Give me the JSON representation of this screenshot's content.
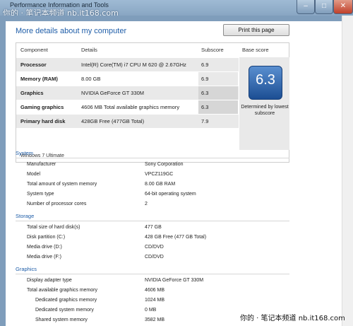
{
  "window": {
    "title": "Performance Information and Tools",
    "watermark_top": "你的 · 笔记本频道 nb.it168.com",
    "minimize": "–",
    "maximize": "□",
    "close": "✕"
  },
  "heading": "More details about my computer",
  "print_button": "Print this page",
  "score_table": {
    "headers": [
      "Component",
      "Details",
      "Subscore",
      "Base score"
    ],
    "rows": [
      {
        "component": "Processor",
        "details": "Intel(R) Core(TM) i7 CPU M 620 @ 2.67GHz",
        "subscore": "6.9"
      },
      {
        "component": "Memory (RAM)",
        "details": "8.00 GB",
        "subscore": "6.9"
      },
      {
        "component": "Graphics",
        "details": "NVIDIA GeForce GT 330M",
        "subscore": "6.3"
      },
      {
        "component": "Gaming graphics",
        "details": "4606 MB Total available graphics memory",
        "subscore": "6.3"
      },
      {
        "component": "Primary hard disk",
        "details": "428GB Free (477GB Total)",
        "subscore": "7.9"
      }
    ],
    "base_score": "6.3",
    "base_desc": "Determined by lowest subscore",
    "os": "Windows 7 Ultimate"
  },
  "system": {
    "title": "System",
    "items": [
      {
        "label": "Manufacturer",
        "value": "Sony Corporation"
      },
      {
        "label": "Model",
        "value": "VPCZ119GC"
      },
      {
        "label": "Total amount of system memory",
        "value": "8.00 GB RAM"
      },
      {
        "label": "System type",
        "value": "64-bit operating system"
      },
      {
        "label": "Number of processor cores",
        "value": "2"
      }
    ]
  },
  "storage": {
    "title": "Storage",
    "items": [
      {
        "label": "Total size of hard disk(s)",
        "value": "477 GB"
      },
      {
        "label": "Disk partition (C:)",
        "value": "428 GB Free (477 GB Total)"
      },
      {
        "label": "Media drive (D:)",
        "value": "CD/DVD"
      },
      {
        "label": "Media drive (F:)",
        "value": "CD/DVD"
      }
    ]
  },
  "graphics": {
    "title": "Graphics",
    "items": [
      {
        "label": "Display adapter type",
        "value": "NVIDIA GeForce GT 330M"
      },
      {
        "label": "Total available graphics memory",
        "value": "4606 MB"
      },
      {
        "label": "Dedicated graphics memory",
        "value": "1024 MB"
      },
      {
        "label": "Dedicated system memory",
        "value": "0 MB"
      },
      {
        "label": "Shared system memory",
        "value": "3582 MB"
      }
    ]
  },
  "watermark_bottom": "你的 · 笔记本频道  nb.it168.com"
}
